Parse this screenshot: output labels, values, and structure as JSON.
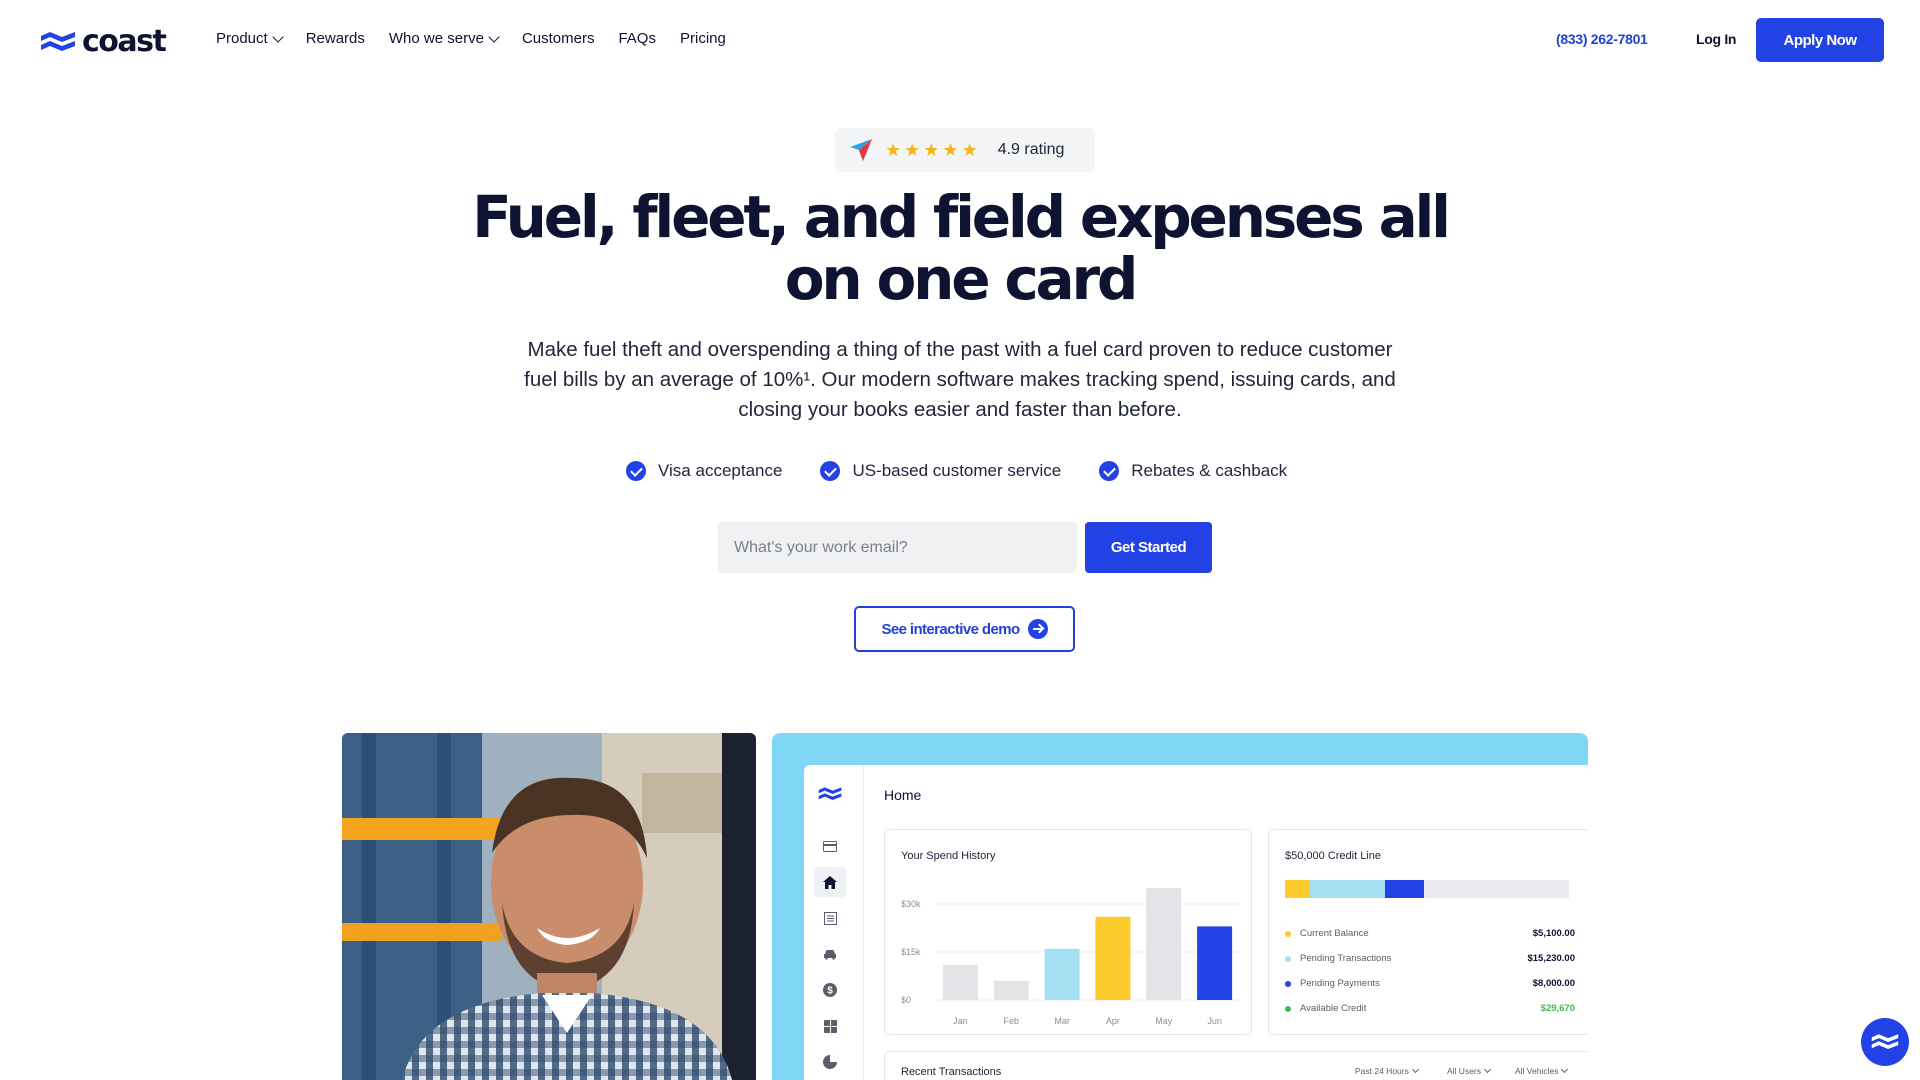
{
  "brand": {
    "name": "coast"
  },
  "nav": {
    "items": [
      {
        "label": "Product",
        "dropdown": true
      },
      {
        "label": "Rewards",
        "dropdown": false
      },
      {
        "label": "Who we serve",
        "dropdown": true
      },
      {
        "label": "Customers",
        "dropdown": false
      },
      {
        "label": "FAQs",
        "dropdown": false
      },
      {
        "label": "Pricing",
        "dropdown": false
      }
    ],
    "phone": "(833) 262-7801",
    "login_label": "Log In",
    "apply_label": "Apply Now"
  },
  "hero": {
    "rating": {
      "stars": 5,
      "text": "4.9 rating"
    },
    "headline": "Fuel, fleet, and field expenses all on one card",
    "subcopy": "Make fuel theft and overspending a thing of the past with a fuel card proven to reduce customer fuel bills by an average of 10%¹. Our modern software makes tracking spend, issuing cards, and closing your books easier and faster than before.",
    "checks": [
      "Visa acceptance",
      "US-based customer service",
      "Rebates & cashback"
    ],
    "email_placeholder": "What's your work email?",
    "get_started_label": "Get Started",
    "demo_label": "See interactive demo"
  },
  "dashboard": {
    "page_title": "Home",
    "spend_history": {
      "title": "Your Spend History",
      "y_ticks": [
        "$30k",
        "$15k",
        "$0"
      ],
      "months": [
        "Jan",
        "Feb",
        "Mar",
        "Apr",
        "May",
        "Jun"
      ],
      "values_k": [
        11,
        6,
        16,
        26,
        35,
        23
      ],
      "colors": [
        "#e3e4e8",
        "#e3e4e8",
        "#a5e0f2",
        "#fdcb2e",
        "#e3e4e8",
        "#2342e6"
      ]
    },
    "credit_line": {
      "title": "$50,000 Credit Line",
      "rows": [
        {
          "label": "Current Balance",
          "value": "$5,100.00",
          "color": "#fdcb2e"
        },
        {
          "label": "Pending Transactions",
          "value": "$15,230.00",
          "color": "#a5e0f2"
        },
        {
          "label": "Pending Payments",
          "value": "$8,000.00",
          "color": "#2342e6"
        },
        {
          "label": "Available Credit",
          "value": "$29,670",
          "color": "#3dbb4f"
        }
      ]
    },
    "recent": {
      "title": "Recent Transactions",
      "filters": [
        "Past 24 Hours",
        "All Users",
        "All Vehicles"
      ]
    }
  }
}
